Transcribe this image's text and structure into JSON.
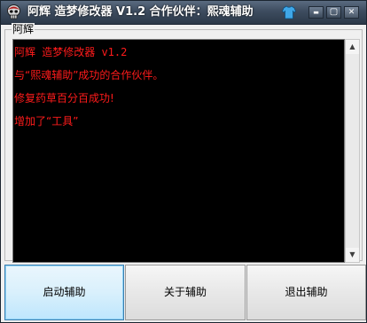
{
  "window": {
    "title": "阿辉 造梦修改器 V1.2 合作伙伴：熙魂辅助",
    "controls": {
      "minimize": "▬",
      "maximize": "▢",
      "close": "✕"
    }
  },
  "group": {
    "label": "阿辉"
  },
  "log": {
    "lines": [
      "阿辉 造梦修改器 v1.2",
      "与“熙魂辅助”成功的合作伙伴。",
      "修复药草百分百成功!",
      "增加了“工具”"
    ]
  },
  "buttons": {
    "start": "启动辅助",
    "about": "关于辅助",
    "exit": "退出辅助"
  },
  "colors": {
    "log_text": "#ff1b1b",
    "log_bg": "#000000",
    "titlebar": "#3d4c5f"
  },
  "icons": {
    "app": "skull-app-icon",
    "skin": "shirt-icon"
  }
}
